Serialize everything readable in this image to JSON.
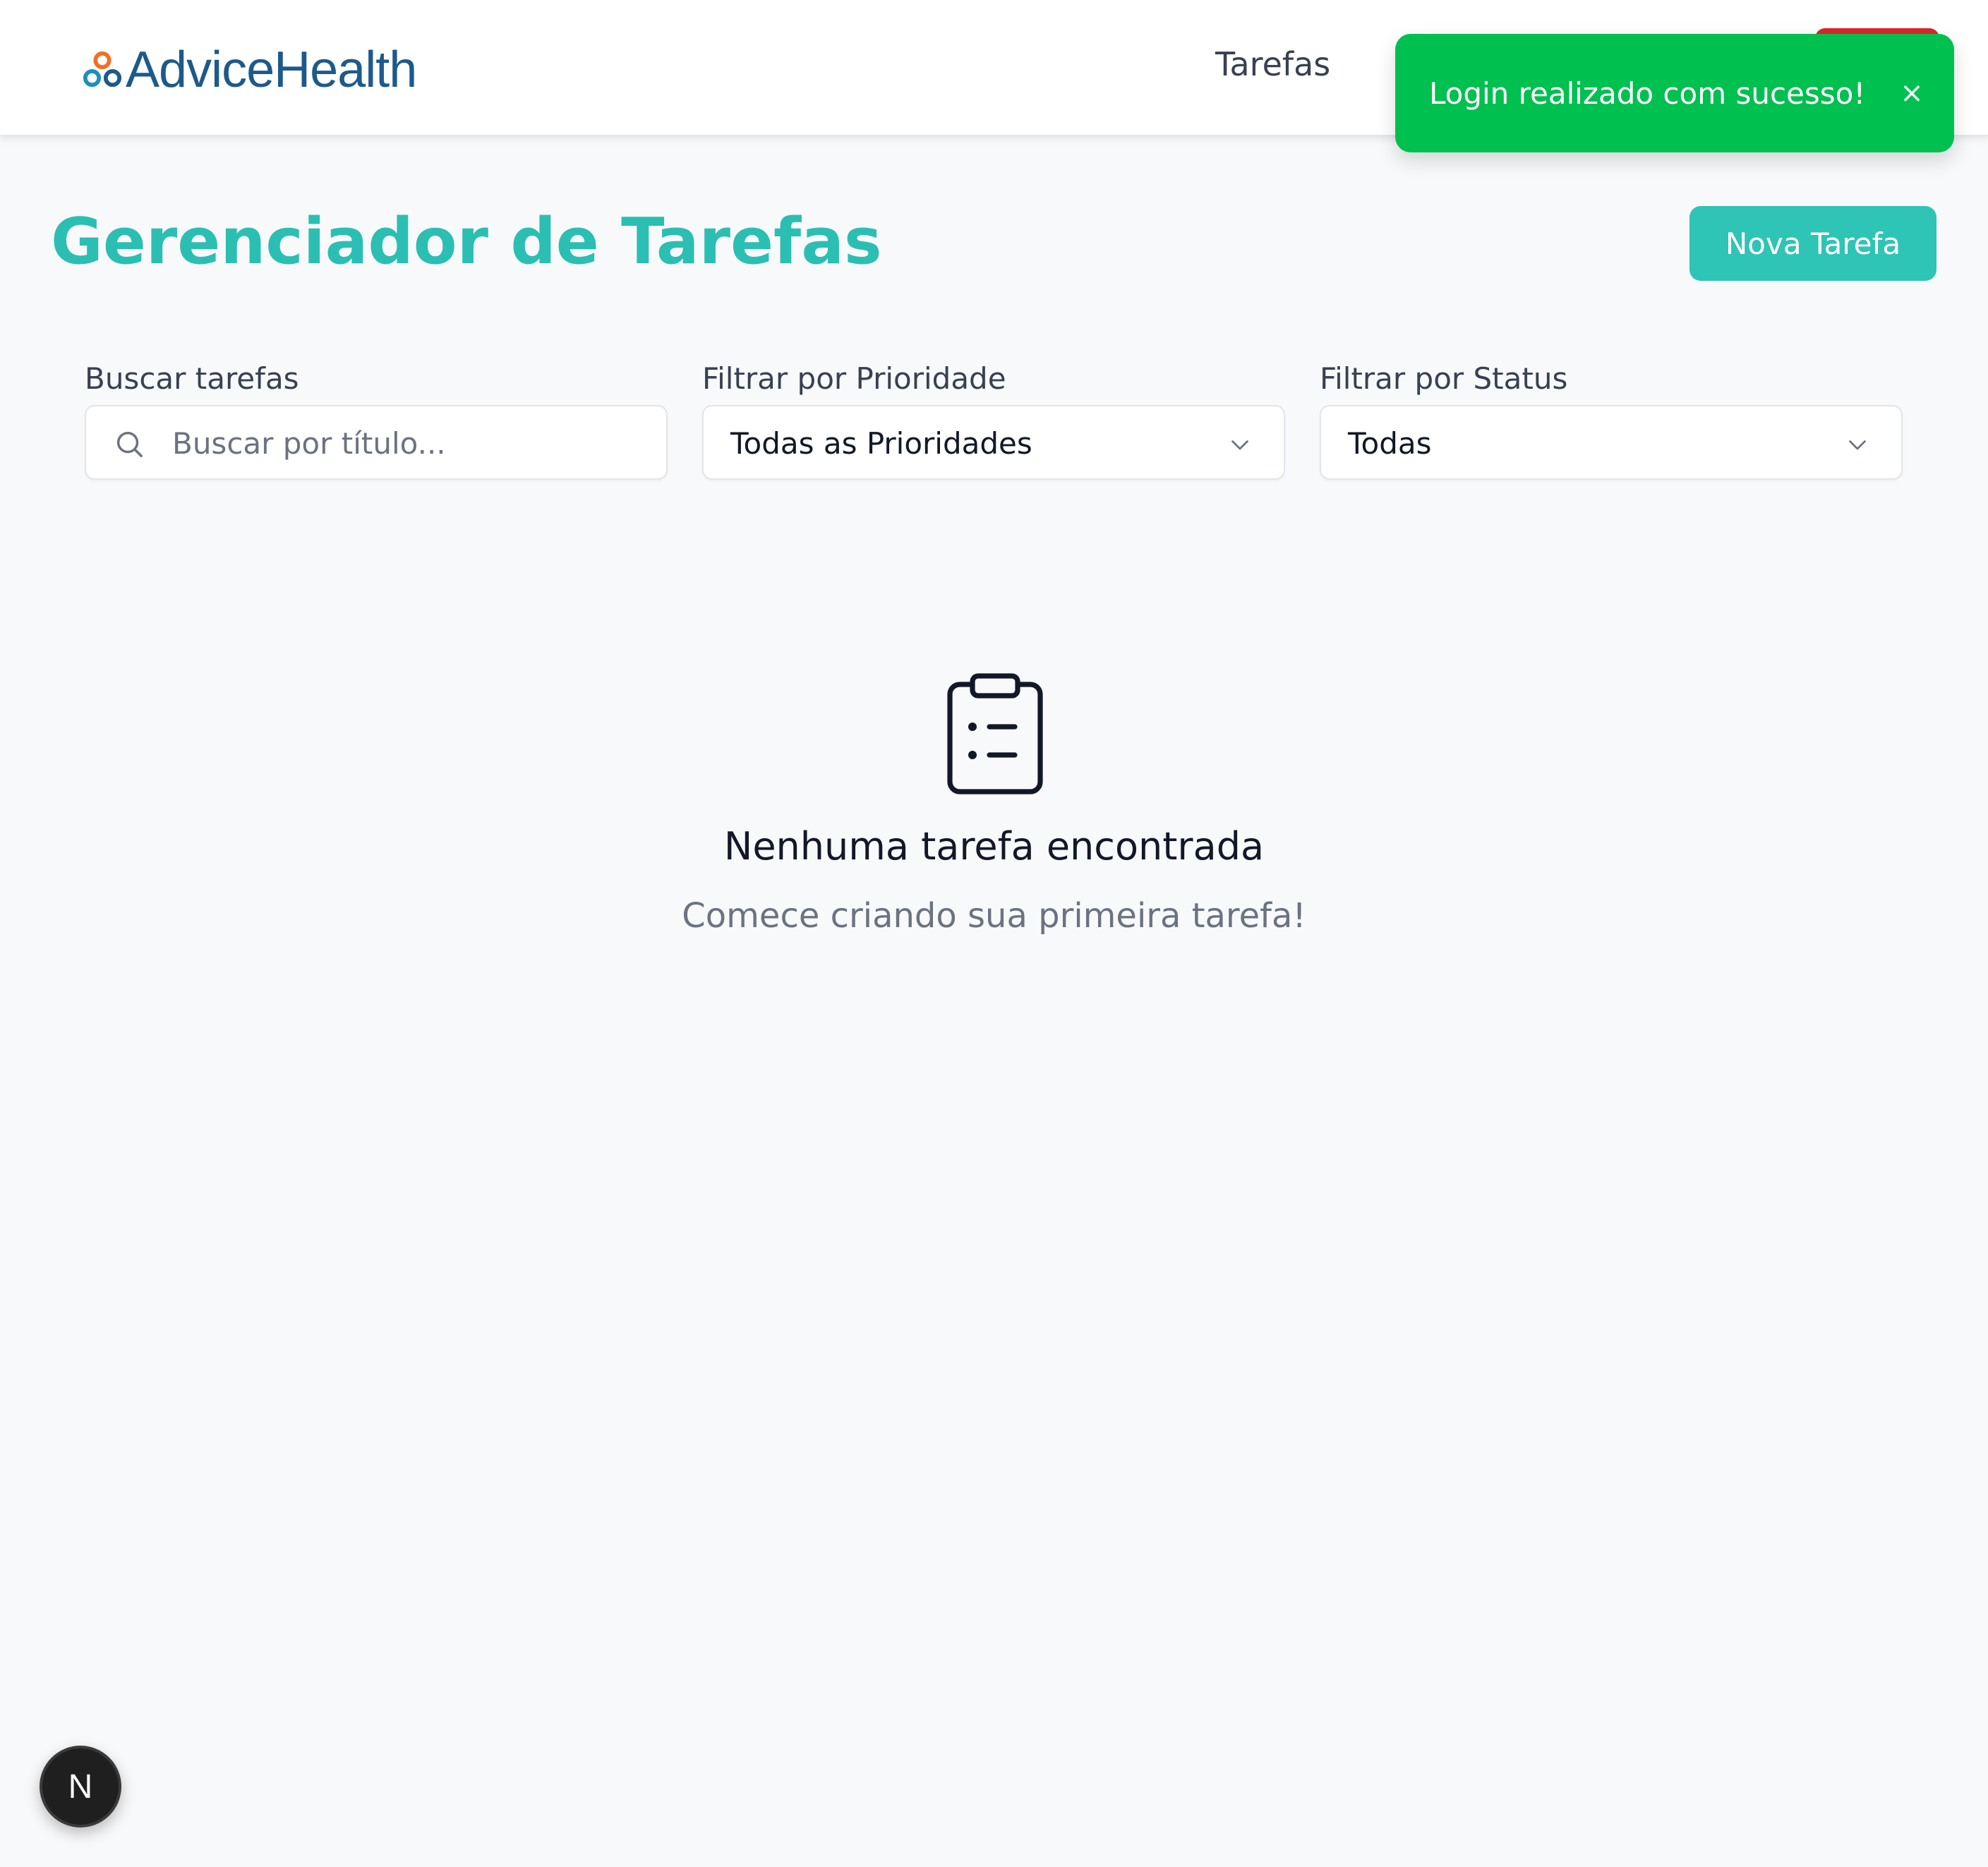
{
  "header": {
    "brand": "AdviceHealth",
    "nav": {
      "tasks_label": "Tarefas"
    }
  },
  "toast": {
    "message": "Login realizado com sucesso!",
    "close_label": "×",
    "color": "#00c04f"
  },
  "main": {
    "title": "Gerenciador de Tarefas",
    "new_task_label": "Nova Tarefa",
    "accent_color": "#2ec4b6"
  },
  "filters": {
    "search": {
      "label": "Buscar tarefas",
      "placeholder": "Buscar por título..."
    },
    "priority": {
      "label": "Filtrar por Prioridade",
      "selected": "Todas as Prioridades"
    },
    "status": {
      "label": "Filtrar por Status",
      "selected": "Todas"
    }
  },
  "empty_state": {
    "icon": "clipboard-list-icon",
    "title": "Nenhuma tarefa encontrada",
    "subtitle": "Comece criando sua primeira tarefa!"
  },
  "devtools": {
    "badge_label": "N"
  }
}
